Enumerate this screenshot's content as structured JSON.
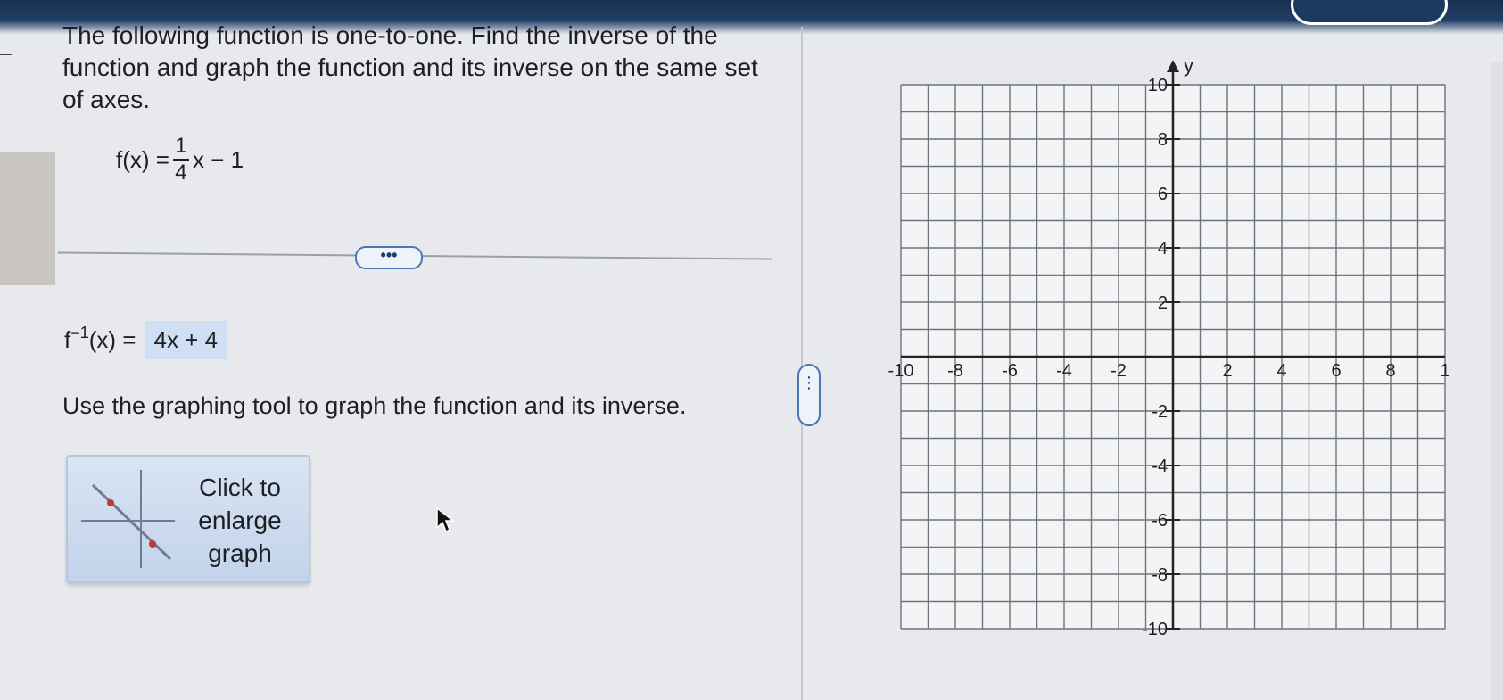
{
  "question": {
    "prompt": "The following function is one-to-one. Find the inverse of the function and graph the function and its inverse on the same set of axes.",
    "function_label": "f(x) =",
    "fraction_numerator": "1",
    "fraction_denominator": "4",
    "function_rest": "x − 1"
  },
  "answer": {
    "inverse_label_base": "f",
    "inverse_label_sup": "−1",
    "inverse_label_rest": "(x) =",
    "inverse_value": "4x + 4"
  },
  "instruction": "Use the graphing tool to graph the function and its inverse.",
  "controls": {
    "more_label": "•••",
    "splitter_label": "⋮",
    "enlarge_label": "Click to enlarge graph"
  },
  "graph": {
    "axis_y_label": "y",
    "x_tick_labels": [
      "-10",
      "-8",
      "-6",
      "-4",
      "-2",
      "2",
      "4",
      "6",
      "8",
      "1"
    ],
    "y_tick_labels": [
      "10",
      "8",
      "6",
      "4",
      "2",
      "-2",
      "-4",
      "-6",
      "-8",
      "-10"
    ],
    "colors": {
      "grid": "#6f747a",
      "axis": "#222222",
      "background": "#f3f4f5"
    }
  }
}
